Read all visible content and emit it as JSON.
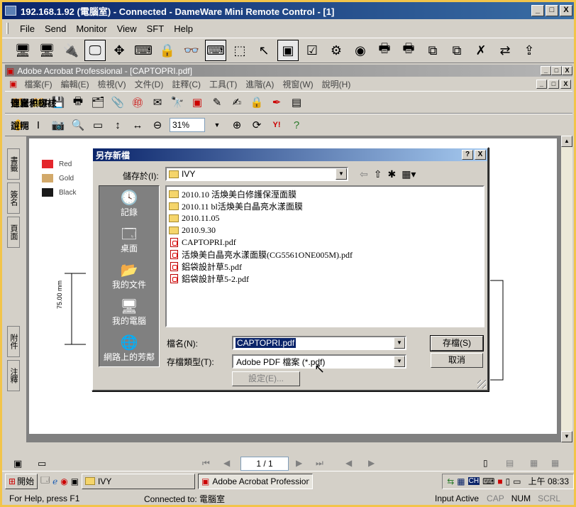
{
  "window": {
    "title": "192.168.1.92 (電腦室) - Connected - DameWare Mini Remote Control - [1]",
    "min": "_",
    "max": "□",
    "close": "X"
  },
  "menubar": [
    "File",
    "Send",
    "Monitor",
    "View",
    "SFT",
    "Help"
  ],
  "acrobat": {
    "title": "Adobe Acrobat Professional - [CAPTOPRI.pdf]",
    "menus": [
      "檔案(F)",
      "編輯(E)",
      "檢視(V)",
      "文件(D)",
      "註釋(C)",
      "工具(T)",
      "進階(A)",
      "視窗(W)",
      "說明(H)"
    ],
    "toolbar": {
      "create_pdf": "建立 PDF",
      "comment_mark": "注釋和標註",
      "send_review": "傳送供審核",
      "secure": "保全",
      "sign": "簽署",
      "select": "選擇",
      "zoom": "31%",
      "help": "說明"
    },
    "sidetabs": [
      "書籤",
      "簽名",
      "頁面",
      "附件",
      "注釋"
    ],
    "legend": [
      {
        "label": "Red",
        "color": "#e4262c"
      },
      {
        "label": "Gold",
        "color": "#d2a96a"
      },
      {
        "label": "Black",
        "color": "#1a1a1a"
      }
    ],
    "dimension_label": "75.00 mm",
    "page_indicator": "1 / 1"
  },
  "dialog": {
    "title": "另存新檔",
    "help_btn": "?",
    "close_btn": "X",
    "save_in_label": "儲存於(I):",
    "save_in_value": "IVY",
    "places": [
      "記錄",
      "桌面",
      "我的文件",
      "我的電腦",
      "網路上的芳鄰"
    ],
    "files": [
      {
        "name": "2010.10 活煥美白修護保溼面膜",
        "type": "folder"
      },
      {
        "name": "2010.11 bl活煥美白晶亮水漾面膜",
        "type": "folder"
      },
      {
        "name": "2010.11.05",
        "type": "folder"
      },
      {
        "name": "2010.9.30",
        "type": "folder"
      },
      {
        "name": "CAPTOPRI.pdf",
        "type": "pdf"
      },
      {
        "name": "活煥美白晶亮水漾面膜(CG5561ONE005M).pdf",
        "type": "pdf"
      },
      {
        "name": "鋁袋設計草5.pdf",
        "type": "pdf"
      },
      {
        "name": "鋁袋設計草5-2.pdf",
        "type": "pdf"
      }
    ],
    "filename_label": "檔名(N):",
    "filename_value": "CAPTOPRI.pdf",
    "filetype_label": "存檔類型(T):",
    "filetype_value": "Adobe PDF 檔案 (*.pdf)",
    "settings_btn": "設定(E)...",
    "save_btn": "存檔(S)",
    "cancel_btn": "取消"
  },
  "taskbar": {
    "start": "開始",
    "folder_task": "IVY",
    "acrobat_task": "Adobe Acrobat Professiona...",
    "clock": "上午 08:33",
    "tray_ime": "CH"
  },
  "status": {
    "help": "For Help, press F1",
    "connected": "Connected to: 電腦室",
    "input": "Input Active",
    "keys": [
      "CAP",
      "NUM",
      "SCRL"
    ]
  }
}
